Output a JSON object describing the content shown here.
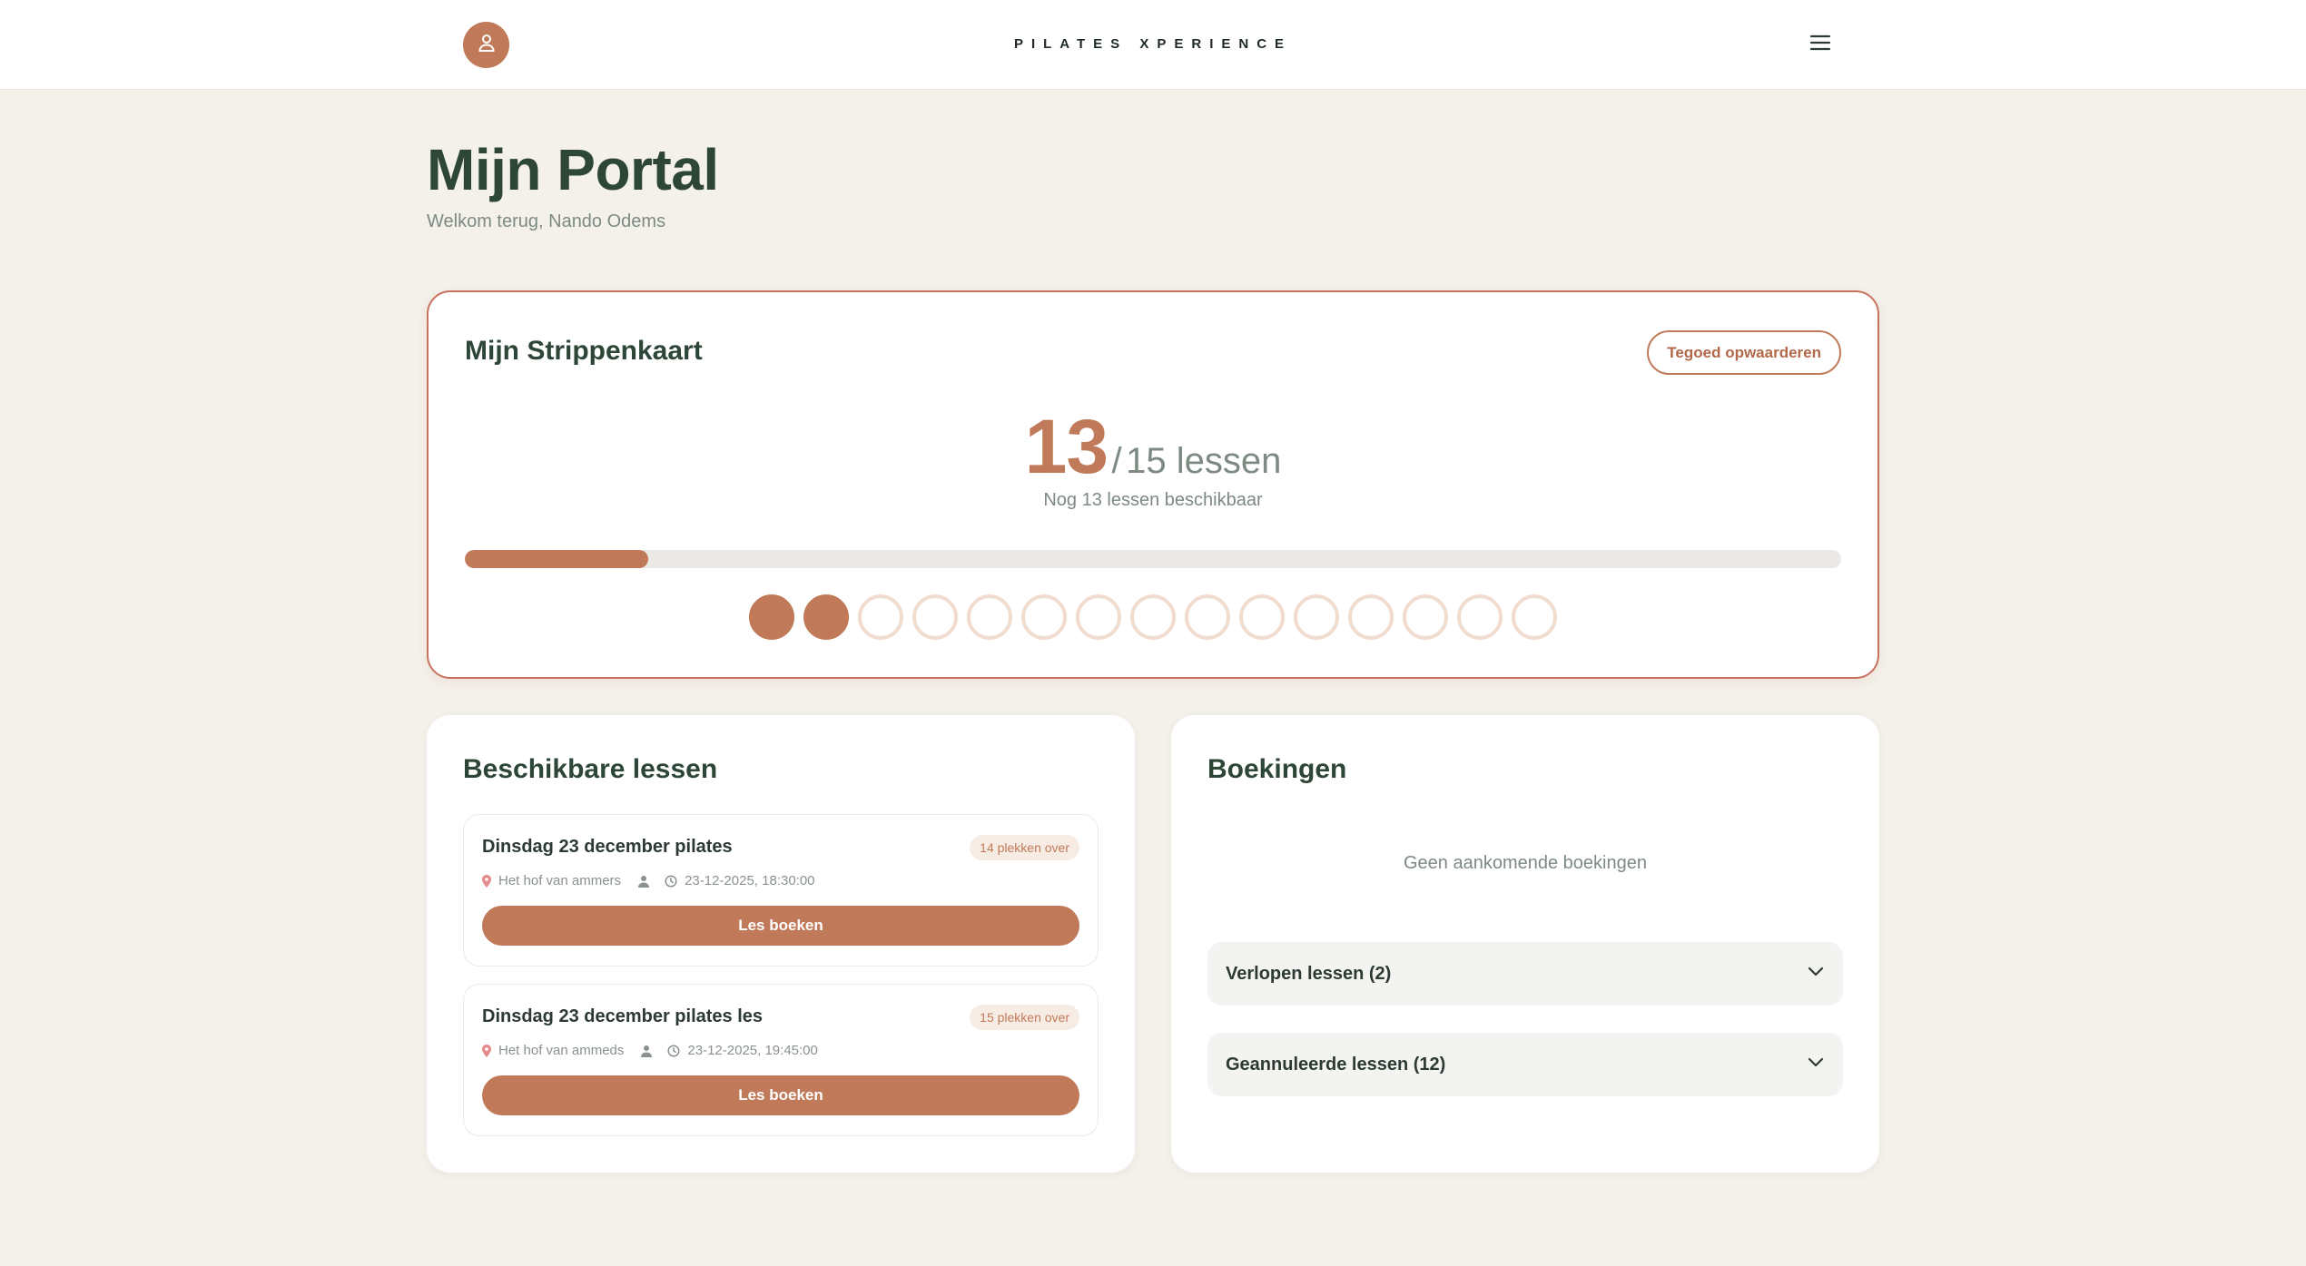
{
  "header": {
    "brand": "PILATES XPERIENCE",
    "icons": {
      "profile": "user-icon",
      "menu": "hamburger-menu-icon"
    },
    "accent_color": "#c07a59"
  },
  "page": {
    "title": "Mijn Portal",
    "welcome": "Welkom terug, Nando Odems"
  },
  "strippenkaart": {
    "title": "Mijn Strippenkaart",
    "topup_label": "Tegoed opwaarderen",
    "remaining": "13",
    "separator": "/",
    "total_label": "15 lessen",
    "available_text": "Nog 13 lessen beschikbaar",
    "progress_percent": 13.3,
    "total_strips": 15,
    "used_strips": 2
  },
  "lessons": {
    "title": "Beschikbare lessen",
    "items": [
      {
        "title": "Dinsdag 23 december pilates",
        "spots": "14 plekken over",
        "location": "Het hof van ammers",
        "datetime": "23-12-2025, 18:30:00",
        "button": "Les boeken"
      },
      {
        "title": "Dinsdag 23 december pilates les",
        "spots": "15 plekken over",
        "location": "Het hof van ammeds",
        "datetime": "23-12-2025, 19:45:00",
        "button": "Les boeken"
      }
    ]
  },
  "bookings": {
    "title": "Boekingen",
    "empty": "Geen aankomende boekingen",
    "expired_label": "Verlopen lessen (2)",
    "cancelled_label": "Geannuleerde lessen (12)"
  }
}
